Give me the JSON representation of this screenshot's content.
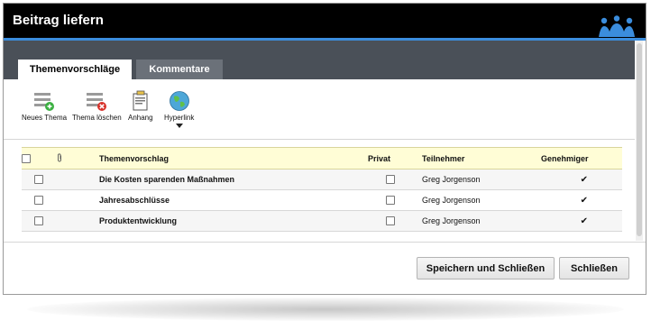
{
  "window": {
    "title": "Beitrag liefern"
  },
  "tabs": [
    {
      "label": "Themenvorschläge",
      "active": true
    },
    {
      "label": "Kommentare",
      "active": false
    }
  ],
  "toolbar": {
    "new_topic": "Neues Thema",
    "delete_topic": "Thema löschen",
    "attachment": "Anhang",
    "hyperlink": "Hyperlink"
  },
  "table": {
    "headers": {
      "topic": "Themenvorschlag",
      "private": "Privat",
      "participant": "Teilnehmer",
      "approver": "Genehmiger"
    },
    "rows": [
      {
        "topic": "Die Kosten sparenden Maßnahmen",
        "participant": "Greg Jorgenson",
        "approver": "✔"
      },
      {
        "topic": "Jahresabschlüsse",
        "participant": "Greg Jorgenson",
        "approver": "✔"
      },
      {
        "topic": "Produktentwicklung",
        "participant": "Greg Jorgenson",
        "approver": "✔"
      }
    ]
  },
  "buttons": {
    "save_close": "Speichern und Schließen",
    "close": "Schließen"
  },
  "colors": {
    "titlebar_bg": "#000000",
    "accent": "#3b8ddd",
    "tabbar_bg": "#4a5058",
    "header_row_bg": "#fffdd6"
  }
}
